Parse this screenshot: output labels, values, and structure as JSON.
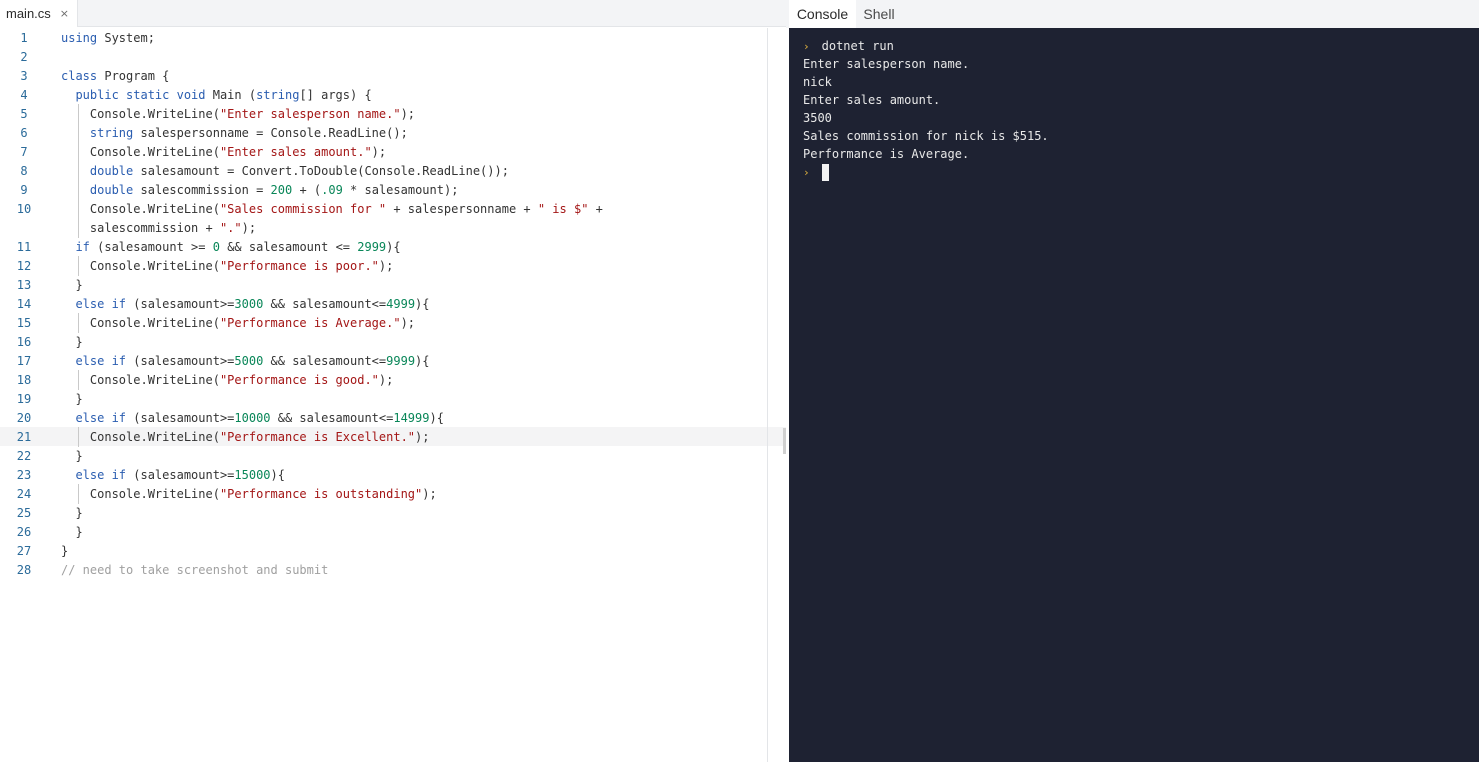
{
  "editor": {
    "file_tab": {
      "label": "main.cs",
      "close": "×"
    },
    "lines": [
      {
        "n": "1",
        "segs": [
          [
            "kw",
            "using"
          ],
          [
            "pl",
            " System;"
          ]
        ]
      },
      {
        "n": "2",
        "segs": []
      },
      {
        "n": "3",
        "segs": [
          [
            "kw",
            "class"
          ],
          [
            "pl",
            " Program {"
          ]
        ]
      },
      {
        "n": "4",
        "segs": [
          [
            "pl",
            "  "
          ],
          [
            "kw",
            "public static void"
          ],
          [
            "pl",
            " Main ("
          ],
          [
            "kw",
            "string"
          ],
          [
            "pl",
            "[] args) {"
          ]
        ]
      },
      {
        "n": "5",
        "segs": [
          [
            "pl",
            "    Console.WriteLine("
          ],
          [
            "str",
            "\"Enter salesperson name.\""
          ],
          [
            "pl",
            ");"
          ]
        ]
      },
      {
        "n": "6",
        "segs": [
          [
            "pl",
            "    "
          ],
          [
            "kw",
            "string"
          ],
          [
            "pl",
            " salespersonname = Console.ReadLine();"
          ]
        ]
      },
      {
        "n": "7",
        "segs": [
          [
            "pl",
            "    Console.WriteLine("
          ],
          [
            "str",
            "\"Enter sales amount.\""
          ],
          [
            "pl",
            ");"
          ]
        ]
      },
      {
        "n": "8",
        "segs": [
          [
            "pl",
            "    "
          ],
          [
            "kw",
            "double"
          ],
          [
            "pl",
            " salesamount = Convert.ToDouble(Console.ReadLine());"
          ]
        ]
      },
      {
        "n": "9",
        "segs": [
          [
            "pl",
            "    "
          ],
          [
            "kw",
            "double"
          ],
          [
            "pl",
            " salescommission = "
          ],
          [
            "num",
            "200"
          ],
          [
            "pl",
            " + ("
          ],
          [
            "num",
            ".09"
          ],
          [
            "pl",
            " * salesamount);"
          ]
        ]
      },
      {
        "n": "10",
        "segs": [
          [
            "pl",
            "    Console.WriteLine("
          ],
          [
            "str",
            "\"Sales commission for \""
          ],
          [
            "pl",
            " + salespersonname + "
          ],
          [
            "str",
            "\" is $\""
          ],
          [
            "pl",
            " +"
          ]
        ]
      },
      {
        "n": "",
        "segs": [
          [
            "pl",
            "    salescommission + "
          ],
          [
            "str",
            "\".\""
          ],
          [
            "pl",
            ");"
          ]
        ]
      },
      {
        "n": "11",
        "segs": [
          [
            "pl",
            "  "
          ],
          [
            "kw",
            "if"
          ],
          [
            "pl",
            " (salesamount >= "
          ],
          [
            "num",
            "0"
          ],
          [
            "pl",
            " && salesamount <= "
          ],
          [
            "num",
            "2999"
          ],
          [
            "pl",
            "){"
          ]
        ]
      },
      {
        "n": "12",
        "segs": [
          [
            "pl",
            "    Console.WriteLine("
          ],
          [
            "str",
            "\"Performance is poor.\""
          ],
          [
            "pl",
            ");"
          ]
        ]
      },
      {
        "n": "13",
        "segs": [
          [
            "pl",
            "  }"
          ]
        ]
      },
      {
        "n": "14",
        "segs": [
          [
            "pl",
            "  "
          ],
          [
            "kw",
            "else if"
          ],
          [
            "pl",
            " (salesamount>="
          ],
          [
            "num",
            "3000"
          ],
          [
            "pl",
            " && salesamount<="
          ],
          [
            "num",
            "4999"
          ],
          [
            "pl",
            "){"
          ]
        ]
      },
      {
        "n": "15",
        "segs": [
          [
            "pl",
            "    Console.WriteLine("
          ],
          [
            "str",
            "\"Performance is Average.\""
          ],
          [
            "pl",
            ");"
          ]
        ]
      },
      {
        "n": "16",
        "segs": [
          [
            "pl",
            "  }"
          ]
        ]
      },
      {
        "n": "17",
        "segs": [
          [
            "pl",
            "  "
          ],
          [
            "kw",
            "else if"
          ],
          [
            "pl",
            " (salesamount>="
          ],
          [
            "num",
            "5000"
          ],
          [
            "pl",
            " && salesamount<="
          ],
          [
            "num",
            "9999"
          ],
          [
            "pl",
            "){"
          ]
        ]
      },
      {
        "n": "18",
        "segs": [
          [
            "pl",
            "    Console.WriteLine("
          ],
          [
            "str",
            "\"Performance is good.\""
          ],
          [
            "pl",
            ");"
          ]
        ]
      },
      {
        "n": "19",
        "segs": [
          [
            "pl",
            "  }"
          ]
        ]
      },
      {
        "n": "20",
        "segs": [
          [
            "pl",
            "  "
          ],
          [
            "kw",
            "else if"
          ],
          [
            "pl",
            " (salesamount>="
          ],
          [
            "num",
            "10000"
          ],
          [
            "pl",
            " && salesamount<="
          ],
          [
            "num",
            "14999"
          ],
          [
            "pl",
            "){"
          ]
        ]
      },
      {
        "n": "21",
        "segs": [
          [
            "pl",
            "    Console.WriteLine("
          ],
          [
            "str",
            "\"Performance is Excellent.\""
          ],
          [
            "pl",
            ");"
          ]
        ]
      },
      {
        "n": "22",
        "segs": [
          [
            "pl",
            "  }"
          ]
        ]
      },
      {
        "n": "23",
        "segs": [
          [
            "pl",
            "  "
          ],
          [
            "kw",
            "else if"
          ],
          [
            "pl",
            " (salesamount>="
          ],
          [
            "num",
            "15000"
          ],
          [
            "pl",
            "){"
          ]
        ]
      },
      {
        "n": "24",
        "segs": [
          [
            "pl",
            "    Console.WriteLine("
          ],
          [
            "str",
            "\"Performance is outstanding\""
          ],
          [
            "pl",
            ");"
          ]
        ]
      },
      {
        "n": "25",
        "segs": [
          [
            "pl",
            "  }"
          ]
        ]
      },
      {
        "n": "26",
        "segs": [
          [
            "pl",
            "  }"
          ]
        ]
      },
      {
        "n": "27",
        "segs": [
          [
            "pl",
            "}"
          ]
        ]
      },
      {
        "n": "28",
        "segs": [
          [
            "cmt",
            "// need to take screenshot and submit"
          ]
        ]
      }
    ]
  },
  "console": {
    "tabs": {
      "console": "Console",
      "shell": "Shell"
    },
    "prompt_glyph": "›",
    "command": "dotnet run",
    "output": [
      "Enter salesperson name.",
      "nick",
      "Enter sales amount.",
      "3500",
      "Sales commission for nick is $515.",
      "Performance is Average."
    ]
  }
}
